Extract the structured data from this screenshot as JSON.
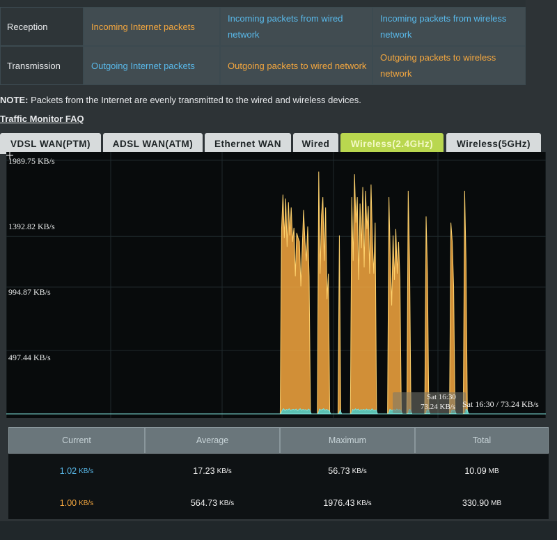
{
  "legend": {
    "rows": [
      {
        "label": "Reception",
        "cells": [
          {
            "text": "Incoming Internet packets",
            "color": "orange"
          },
          {
            "text": "Incoming packets from wired network",
            "color": "blue"
          },
          {
            "text": "Incoming packets from wireless network",
            "color": "blue"
          }
        ]
      },
      {
        "label": "Transmission",
        "cells": [
          {
            "text": "Outgoing Internet packets",
            "color": "blue"
          },
          {
            "text": "Outgoing packets to wired network",
            "color": "orange"
          },
          {
            "text": "Outgoing packets to wireless network",
            "color": "orange"
          }
        ]
      }
    ]
  },
  "note": {
    "label": "NOTE:",
    "text": "Packets from the Internet are evenly transmitted to the wired and wireless devices."
  },
  "faq_link": "Traffic Monitor FAQ",
  "tabs": [
    {
      "label": "VDSL WAN(PTM)",
      "active": false
    },
    {
      "label": "ADSL WAN(ATM)",
      "active": false
    },
    {
      "label": "Ethernet WAN",
      "active": false
    },
    {
      "label": "Wired",
      "active": false
    },
    {
      "label": "Wireless(2.4GHz)",
      "active": true
    },
    {
      "label": "Wireless(5GHz)",
      "active": false
    }
  ],
  "chart": {
    "y_labels": [
      "1989.75 KB/s",
      "1392.82 KB/s",
      "994.87 KB/s",
      "497.44 KB/s"
    ],
    "tooltip": {
      "time": "Sat 16:30",
      "value": "73.24 KB/s"
    },
    "readout": "Sat 16:30 / 73.24 KB/s"
  },
  "chart_data": {
    "type": "area",
    "ylim": [
      0,
      1989.75
    ],
    "y_ticks": [
      497.44,
      994.87,
      1392.82,
      1989.75
    ],
    "grid": true,
    "series": [
      {
        "color": "#f4a73f",
        "values": [
          0,
          0,
          0,
          0,
          0,
          0,
          0,
          0,
          0,
          0,
          0,
          0,
          0,
          0,
          0,
          0,
          0,
          0,
          0,
          0,
          0,
          0,
          0,
          0,
          0,
          0,
          0,
          0,
          0,
          0,
          0,
          0,
          0,
          0,
          0,
          0,
          0,
          0,
          0,
          0,
          0,
          0,
          0,
          0,
          0,
          0,
          0,
          0,
          0,
          0,
          0,
          0,
          0,
          0,
          0,
          0,
          0,
          0,
          0,
          0,
          0,
          0,
          0,
          0,
          0,
          0,
          0,
          0,
          0,
          0,
          0,
          0,
          0,
          0,
          0,
          0,
          0,
          0,
          0,
          0,
          0,
          0,
          0,
          0,
          0,
          0,
          0,
          0,
          0,
          0,
          0,
          0,
          0,
          0,
          0,
          0,
          0,
          0,
          0,
          0,
          0,
          0,
          0,
          0,
          0,
          0,
          0,
          0,
          0,
          0,
          0,
          0,
          0,
          0,
          0,
          0,
          0,
          0,
          0,
          0,
          0,
          0,
          0,
          0,
          0,
          0,
          0,
          0,
          0,
          0,
          0,
          0,
          0,
          0,
          0,
          0,
          0,
          0,
          0,
          0,
          0,
          0,
          0,
          0,
          0,
          0,
          0,
          0,
          0,
          0,
          0,
          0,
          0,
          0,
          0,
          0,
          0,
          0,
          0,
          0,
          0,
          0,
          0,
          0,
          0,
          0,
          0,
          0,
          0,
          0,
          0,
          0,
          0,
          0,
          0,
          0,
          0,
          0,
          0,
          0,
          0,
          0,
          0,
          0,
          0,
          0,
          0,
          0,
          0,
          0,
          0,
          0,
          0,
          0,
          0,
          0,
          0,
          0,
          0,
          0,
          1450,
          1720,
          1380,
          1690,
          1310,
          1660,
          1400,
          1620,
          1350,
          1460,
          1080,
          1420,
          1380,
          1350,
          1000,
          1300,
          1600,
          1350,
          1200,
          1470,
          1080,
          0,
          0,
          0,
          0,
          0,
          0,
          1900,
          1100,
          1560,
          1700,
          1200,
          1620,
          900,
          1100,
          0,
          0,
          0,
          0,
          0,
          0,
          0,
          1400,
          0,
          0,
          0,
          0,
          0,
          0,
          0,
          0,
          1700,
          1200,
          1880,
          1500,
          1700,
          1050,
          1650,
          1300,
          1780,
          1150,
          1750,
          1450,
          1630,
          1100,
          1800,
          1350,
          1100,
          1500,
          0,
          0,
          0,
          0,
          0,
          0,
          0,
          0,
          0,
          1700,
          1200,
          850,
          1400,
          1050,
          1450,
          1100,
          1350,
          1050,
          0,
          0,
          0,
          0,
          0,
          1750,
          1200,
          0,
          0,
          0,
          0,
          0,
          0,
          0,
          0,
          0,
          0,
          0,
          1550,
          1100,
          0,
          0,
          0,
          0,
          0,
          0,
          0,
          0,
          0,
          0,
          0,
          0,
          0,
          0,
          0,
          0,
          1500,
          1350,
          1000,
          0,
          0,
          0,
          0,
          0,
          0,
          0,
          1750,
          1200,
          0,
          0,
          0,
          0,
          0,
          0,
          0,
          0,
          0,
          0,
          0,
          0,
          0,
          0,
          0,
          0,
          0,
          0,
          0,
          0,
          0,
          0,
          0,
          0,
          0,
          0,
          0,
          0,
          0,
          0,
          0,
          0,
          0,
          0,
          0,
          0,
          0,
          0,
          0,
          0,
          0,
          0,
          0,
          0,
          0,
          0,
          0,
          0,
          0,
          0,
          0,
          0,
          0,
          0,
          0,
          0,
          0,
          0
        ]
      },
      {
        "color": "#4fc7c0",
        "values": [
          0,
          0,
          0,
          0,
          0,
          0,
          0,
          0,
          0,
          0,
          0,
          0,
          0,
          0,
          0,
          0,
          0,
          0,
          0,
          0,
          0,
          0,
          0,
          0,
          0,
          0,
          0,
          0,
          0,
          0,
          0,
          0,
          0,
          0,
          0,
          0,
          0,
          0,
          0,
          0,
          0,
          0,
          0,
          0,
          0,
          0,
          0,
          0,
          0,
          0,
          0,
          0,
          0,
          0,
          0,
          0,
          0,
          0,
          0,
          0,
          0,
          0,
          0,
          0,
          0,
          0,
          0,
          0,
          0,
          0,
          0,
          0,
          0,
          0,
          0,
          0,
          0,
          0,
          0,
          0,
          0,
          0,
          0,
          0,
          0,
          0,
          0,
          0,
          0,
          0,
          0,
          0,
          0,
          0,
          0,
          0,
          0,
          0,
          0,
          0,
          0,
          0,
          0,
          0,
          0,
          0,
          0,
          0,
          0,
          0,
          0,
          0,
          0,
          0,
          0,
          0,
          0,
          0,
          0,
          0,
          0,
          0,
          0,
          0,
          0,
          0,
          0,
          0,
          0,
          0,
          0,
          0,
          0,
          0,
          0,
          0,
          0,
          0,
          0,
          0,
          0,
          0,
          0,
          0,
          0,
          0,
          0,
          0,
          0,
          0,
          0,
          0,
          0,
          0,
          0,
          0,
          0,
          0,
          0,
          0,
          0,
          0,
          0,
          0,
          0,
          0,
          0,
          0,
          0,
          0,
          0,
          0,
          0,
          0,
          0,
          0,
          0,
          0,
          0,
          0,
          0,
          0,
          0,
          0,
          0,
          0,
          0,
          0,
          0,
          0,
          0,
          0,
          0,
          0,
          0,
          0,
          0,
          0,
          0,
          0,
          30,
          40,
          25,
          35,
          30,
          40,
          28,
          32,
          36,
          30,
          38,
          25,
          33,
          40,
          28,
          36,
          30,
          34,
          26,
          38,
          30,
          0,
          0,
          0,
          0,
          0,
          0,
          38,
          30,
          34,
          40,
          28,
          36,
          30,
          26,
          0,
          0,
          0,
          0,
          0,
          0,
          0,
          30,
          0,
          0,
          0,
          0,
          0,
          0,
          0,
          0,
          35,
          28,
          40,
          30,
          38,
          26,
          34,
          30,
          36,
          28,
          38,
          30,
          34,
          26,
          40,
          30,
          28,
          32,
          0,
          0,
          0,
          0,
          0,
          0,
          0,
          0,
          0,
          36,
          28,
          30,
          34,
          26,
          38,
          30,
          34,
          28,
          0,
          0,
          0,
          0,
          0,
          36,
          30,
          0,
          0,
          0,
          0,
          0,
          0,
          0,
          0,
          0,
          0,
          0,
          34,
          28,
          0,
          0,
          0,
          0,
          0,
          0,
          0,
          0,
          0,
          0,
          0,
          0,
          0,
          0,
          0,
          0,
          32,
          28,
          30,
          0,
          0,
          0,
          0,
          0,
          0,
          0,
          36,
          30,
          0,
          0,
          0,
          0,
          0,
          0,
          0,
          0,
          0,
          0,
          0,
          0,
          0,
          0,
          0,
          0,
          0,
          0,
          0,
          0,
          0,
          0,
          0,
          0,
          0,
          0,
          0,
          0,
          0,
          0,
          0,
          0,
          0,
          0,
          0,
          0,
          0,
          0,
          0,
          0,
          0,
          0,
          0,
          0,
          0,
          0,
          0,
          0,
          0,
          0,
          0,
          0,
          0,
          0,
          0,
          0,
          0
        ]
      }
    ]
  },
  "stats": {
    "headers": [
      "Current",
      "Average",
      "Maximum",
      "Total"
    ],
    "rows": [
      {
        "current": "1.02",
        "current_unit": "KB/s",
        "average": "17.23",
        "average_unit": "KB/s",
        "maximum": "56.73",
        "maximum_unit": "KB/s",
        "total": "10.09",
        "total_unit": "MB"
      },
      {
        "current": "1.00",
        "current_unit": "KB/s",
        "average": "564.73",
        "average_unit": "KB/s",
        "maximum": "1976.43",
        "maximum_unit": "KB/s",
        "total": "330.90",
        "total_unit": "MB"
      }
    ]
  }
}
